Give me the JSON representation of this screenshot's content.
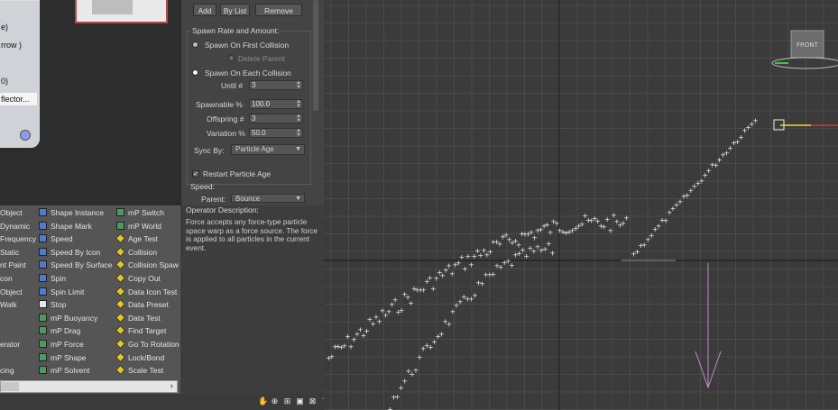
{
  "event_node": {
    "rows": [
      "e)",
      "rrow )",
      "",
      "0)",
      "flector..."
    ],
    "selected_index": 4
  },
  "rollout": {
    "buttons": {
      "add": "Add",
      "by_list": "By List",
      "remove": "Remove"
    },
    "spawn_group_title": "Spawn Rate and Amount:",
    "spawn_first_collision": "Spawn On First Collision",
    "delete_parent": "Delete Parent",
    "spawn_each_collision": "Spawn On Each Collision",
    "until_label": "Until #",
    "until_value": "3",
    "spawnable_label": "Spawnable %",
    "spawnable_value": "100.0",
    "offspring_label": "Offspring #",
    "offspring_value": "3",
    "variation_label": "Variation %",
    "variation_value": "50.0",
    "sync_label": "Sync By:",
    "sync_value": "Particle Age",
    "restart_age": "Restart Particle Age",
    "speed_label": "Speed:",
    "parent_label": "Parent:",
    "parent_value": "Bounce"
  },
  "description": {
    "title": "Operator Description:",
    "text": "Force accepts any force-type particle space warp as a force source. The force is applied to all particles in the current event."
  },
  "depot": {
    "col1": [
      "Object",
      "Dynamic",
      "Frequency",
      "Static",
      "nt Paint",
      "con",
      "Object",
      "Walk",
      "",
      "erator",
      "",
      "cing"
    ],
    "col2": [
      {
        "label": "Shape Instance",
        "icon": "blue"
      },
      {
        "label": "Shape Mark",
        "icon": "blue"
      },
      {
        "label": "Speed",
        "icon": "blue"
      },
      {
        "label": "Speed By Icon",
        "icon": "blue"
      },
      {
        "label": "Speed By Surface",
        "icon": "blue"
      },
      {
        "label": "Spin",
        "icon": "blue"
      },
      {
        "label": "Spin Limit",
        "icon": "blue"
      },
      {
        "label": "Stop",
        "icon": "white"
      },
      {
        "label": "mP Buoyancy",
        "icon": "green"
      },
      {
        "label": "mP Drag",
        "icon": "green"
      },
      {
        "label": "mP Force",
        "icon": "green"
      },
      {
        "label": "mP Shape",
        "icon": "green"
      },
      {
        "label": "mP Solvent",
        "icon": "green"
      }
    ],
    "col3": [
      {
        "label": "mP Switch",
        "icon": "green"
      },
      {
        "label": "mP World",
        "icon": "green"
      },
      {
        "label": "Age Test",
        "icon": "yellow"
      },
      {
        "label": "Collision",
        "icon": "yellow"
      },
      {
        "label": "Collision Spaw",
        "icon": "yellow"
      },
      {
        "label": "Copy Out",
        "icon": "yellow"
      },
      {
        "label": "Data Icon Test",
        "icon": "yellow"
      },
      {
        "label": "Data Preset",
        "icon": "yellow"
      },
      {
        "label": "Data Test",
        "icon": "yellow"
      },
      {
        "label": "Find Target",
        "icon": "yellow"
      },
      {
        "label": "Go To Rotation",
        "icon": "yellow"
      },
      {
        "label": "Lock/Bond",
        "icon": "yellow"
      },
      {
        "label": "Scale Test",
        "icon": "yellow"
      }
    ],
    "scroll_arrow": "›"
  },
  "viewport": {
    "viewcube_label": "FRONT",
    "colors": {
      "grid": "#4a4a4a",
      "axis": "#1e1e1e",
      "particle": "#f2f2f2",
      "gizmo_red": "#d63a2a",
      "gizmo_yellow": "#e6d22a",
      "gizmo_green": "#3ac74a",
      "deflector": "#c08ac8"
    }
  }
}
